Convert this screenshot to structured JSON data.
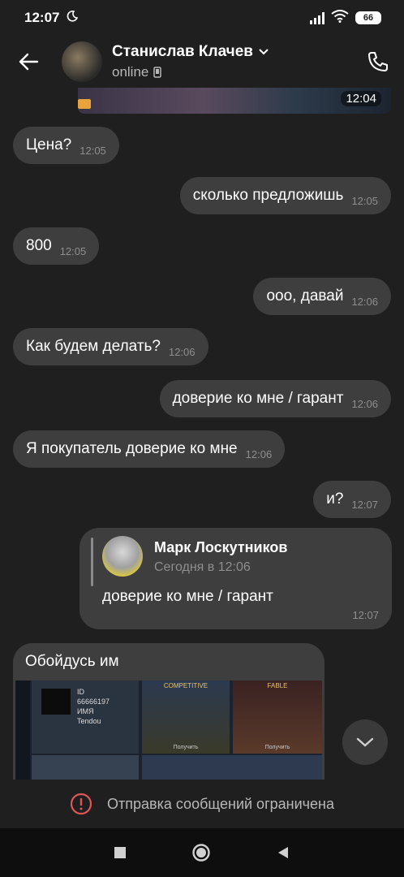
{
  "status_bar": {
    "time": "12:07",
    "battery": "66"
  },
  "header": {
    "name": "Станислав Клачев",
    "status": "online"
  },
  "top_media": {
    "time": "12:04"
  },
  "messages": [
    {
      "text": "Цена?",
      "time": "12:05"
    },
    {
      "text": "сколько предложишь",
      "time": "12:05"
    },
    {
      "text": "800",
      "time": "12:05"
    },
    {
      "text": "ооо, давай",
      "time": "12:06"
    },
    {
      "text": "Как будем делать?",
      "time": "12:06"
    },
    {
      "text": "доверие ко мне / гарант",
      "time": "12:06"
    },
    {
      "text": "Я покупатель доверие ко мне",
      "time": "12:06"
    },
    {
      "text": "и?",
      "time": "12:07"
    }
  ],
  "reply_message": {
    "quoted_author": "Марк Лоскутников",
    "quoted_date": "Сегодня в 12:06",
    "text": "доверие ко мне / гарант",
    "time": "12:07"
  },
  "photo_message": {
    "caption": "Обойдусь им",
    "profile_text": [
      "ID",
      "66666197",
      "ИМЯ",
      "Tendou"
    ],
    "card1_title": "COMPETITIVE",
    "card1_button": "Получить",
    "card2_title": "FABLE",
    "card2_button": "Получить"
  },
  "restricted": {
    "text": "Отправка сообщений ограничена"
  }
}
